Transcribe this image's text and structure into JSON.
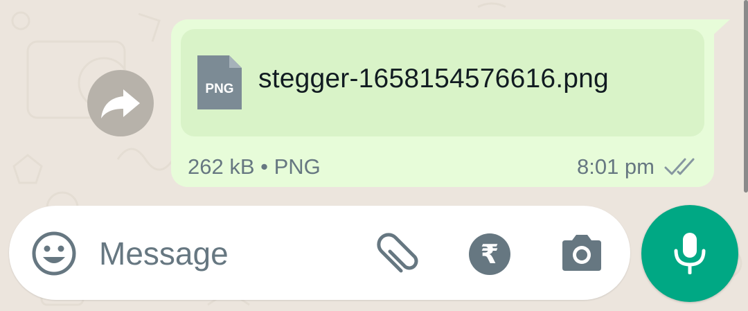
{
  "message": {
    "file_name": "stegger-1658154576616.png",
    "file_type_icon_label": "PNG",
    "file_meta": "262 kB • PNG",
    "time": "8:01 pm",
    "status_icon": "double-check-icon"
  },
  "forward_button": {
    "icon": "forward-icon"
  },
  "composer": {
    "placeholder": "Message",
    "emoji_icon": "emoji-icon",
    "attach_icon": "paperclip-icon",
    "payment_icon": "rupee-icon",
    "payment_symbol": "₹",
    "camera_icon": "camera-icon"
  },
  "send_button": {
    "icon": "mic-icon"
  },
  "colors": {
    "background": "#ece5dd",
    "outgoing_bubble": "#e7fcd9",
    "file_card": "#d9f3c8",
    "accent": "#00a884",
    "meta_text": "#667781"
  }
}
